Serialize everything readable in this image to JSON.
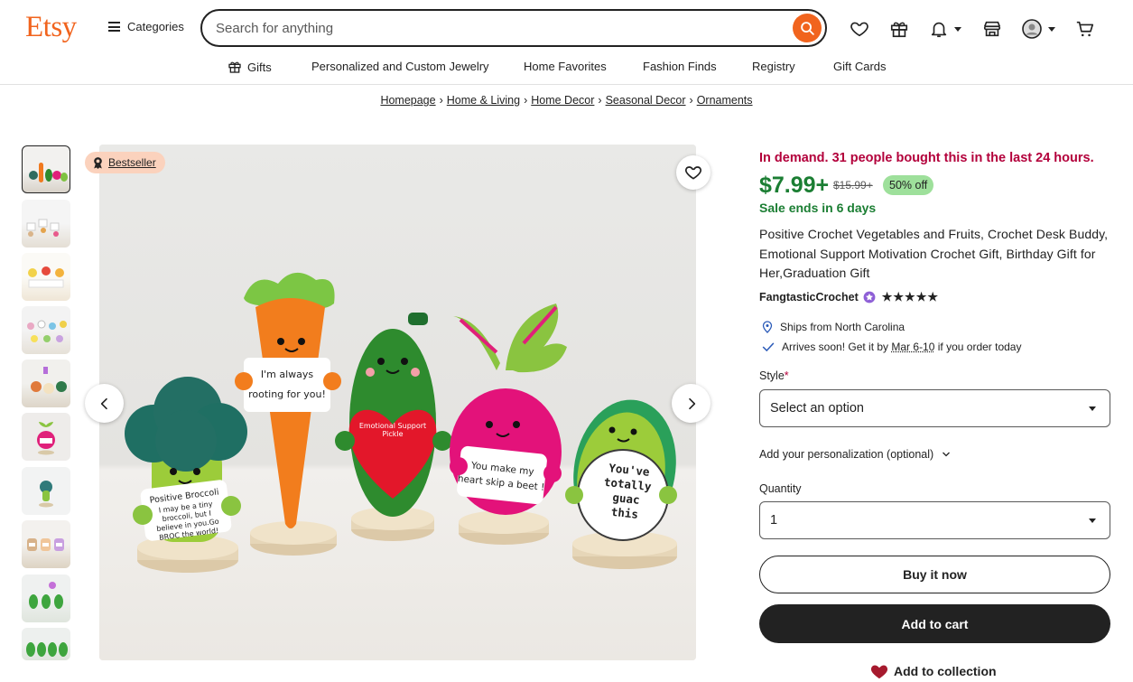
{
  "header": {
    "logo": "Etsy",
    "categories_label": "Categories",
    "search_placeholder": "Search for anything"
  },
  "nav": {
    "items": [
      "Gifts",
      "Personalized and Custom Jewelry",
      "Home Favorites",
      "Fashion Finds",
      "Registry",
      "Gift Cards"
    ]
  },
  "breadcrumbs": [
    "Homepage",
    "Home & Living",
    "Home Decor",
    "Seasonal Decor",
    "Ornaments"
  ],
  "gallery": {
    "badge": "Bestseller",
    "thumb_count": 10,
    "image_sign_texts": {
      "carrot": "I'm always rooting for you!",
      "broccoli": "Positive Broccoli I may be a tiny broccoli, but I believe in you.Go BROC the world!",
      "pickle": "Emotional Support Pickle",
      "beet": "You make my heart skip a beet !",
      "avocado": "You've totally guac this"
    }
  },
  "product": {
    "demand": "In demand. 31 people bought this in the last 24 hours.",
    "price": "$7.99+",
    "old_price": "$15.99+",
    "discount": "50% off",
    "sale_ends": "Sale ends in 6 days",
    "title": "Positive Crochet Vegetables and Fruits, Crochet Desk Buddy, Emotional Support Motivation Crochet Gift, Birthday Gift for Her,Graduation Gift",
    "shop_name": "FangtasticCrochet",
    "rating": 5,
    "stars": "★★★★★",
    "ships_from": "Ships from North Carolina",
    "arrives_prefix": "Arrives soon! Get it by ",
    "arrives_date": "Mar 6-10",
    "arrives_suffix": " if you order today",
    "style_label": "Style",
    "required_mark": "*",
    "style_value": "Select an option",
    "personalization_label": "Add your personalization (optional)",
    "quantity_label": "Quantity",
    "quantity_value": "1",
    "buy_now": "Buy it now",
    "add_to_cart": "Add to cart",
    "add_to_collection": "Add to collection"
  },
  "colors": {
    "brand": "#f1641e",
    "demand": "#b3003b",
    "price": "#1b7e33",
    "discount_bg": "#9ee09b",
    "badge_bg": "#fbd2bd"
  }
}
